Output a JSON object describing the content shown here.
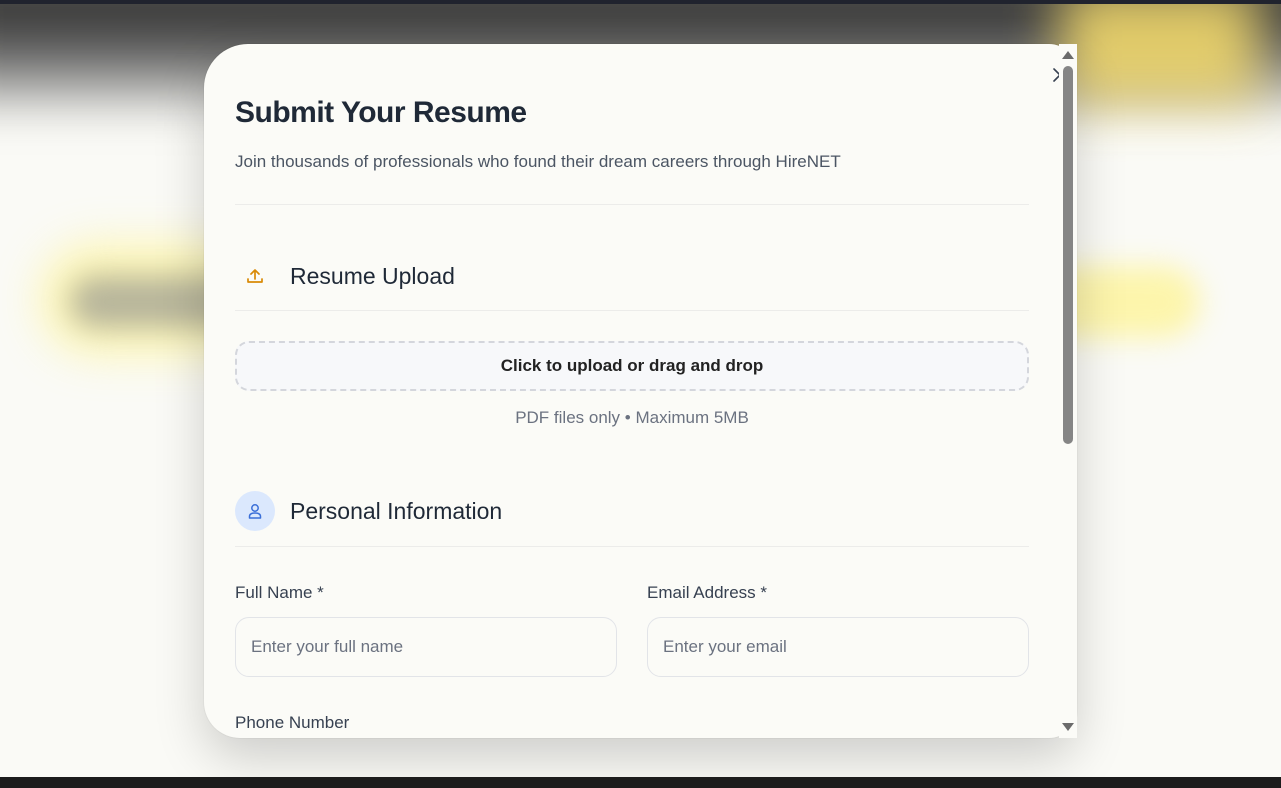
{
  "modal": {
    "title": "Submit Your Resume",
    "subtitle": "Join thousands of professionals who found their dream careers through HireNET",
    "close_icon": "close-icon"
  },
  "resume_section": {
    "title": "Resume Upload",
    "icon": "upload-icon",
    "icon_color": "#d98a06",
    "dropzone_label": "Click to upload or drag and drop",
    "hint": "PDF files only • Maximum 5MB"
  },
  "personal_section": {
    "title": "Personal Information",
    "icon": "user-icon",
    "icon_color": "#3b6fd8",
    "icon_bg": "#dbe8fd",
    "full_name": {
      "label": "Full Name *",
      "placeholder": "Enter your full name",
      "value": ""
    },
    "email": {
      "label": "Email Address *",
      "placeholder": "Enter your email",
      "value": ""
    },
    "phone": {
      "label": "Phone Number"
    }
  }
}
